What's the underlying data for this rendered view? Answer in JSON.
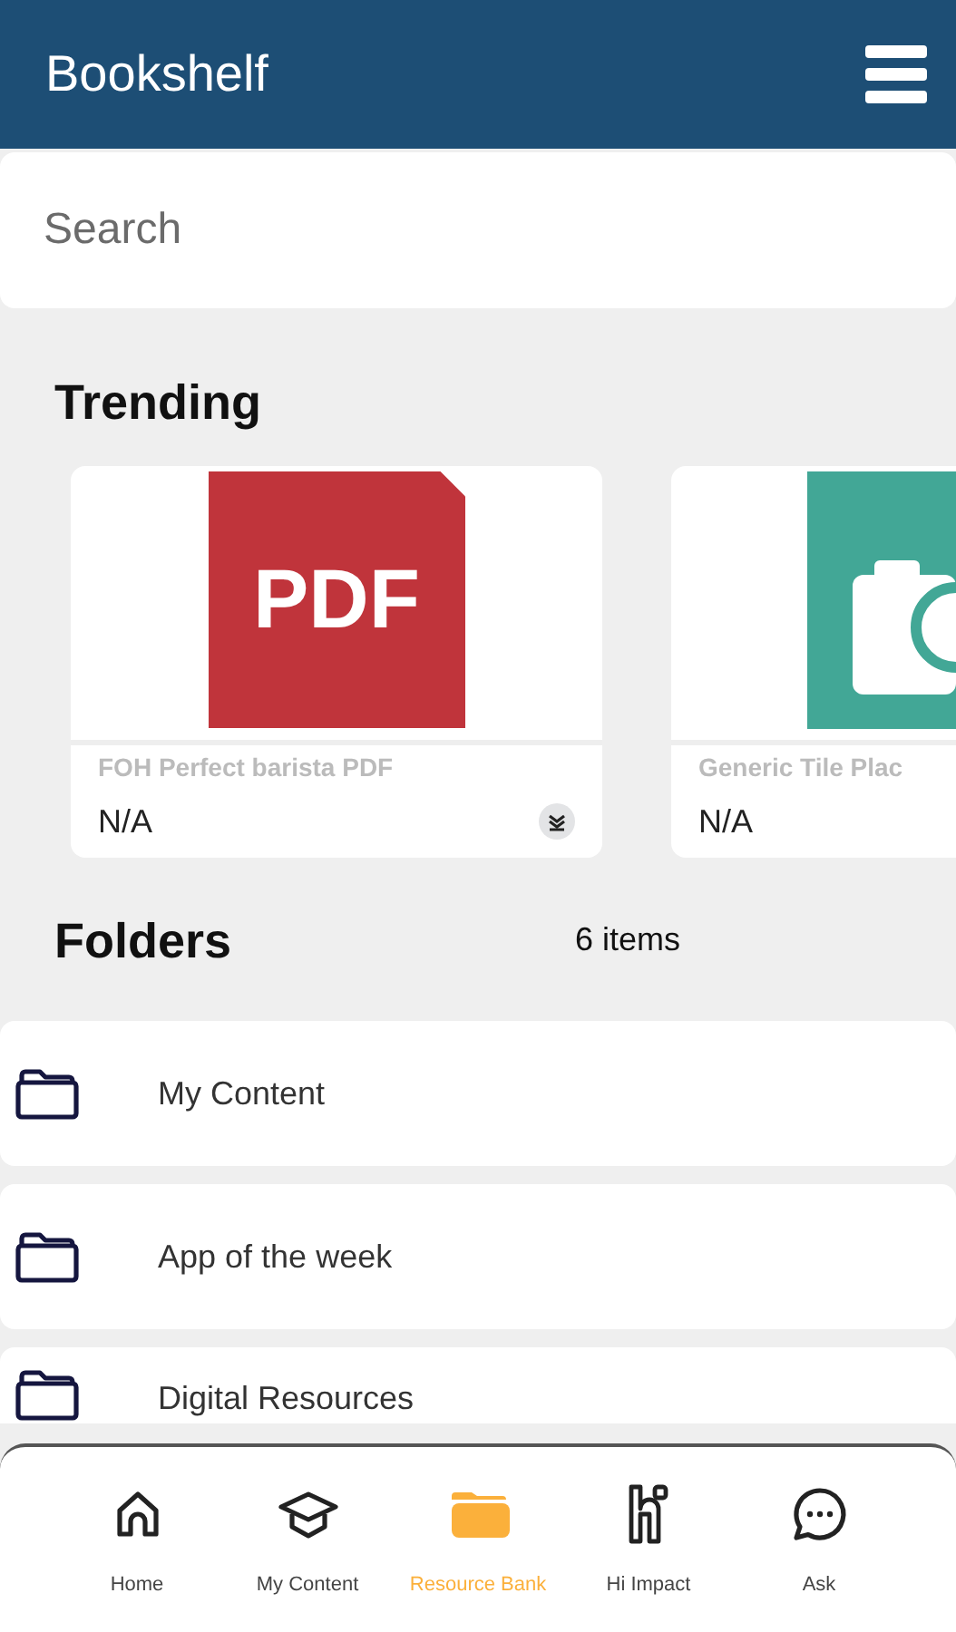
{
  "header": {
    "title": "Bookshelf"
  },
  "search": {
    "placeholder": "Search"
  },
  "trending": {
    "title": "Trending",
    "items": [
      {
        "kind": "pdf",
        "badge": "PDF",
        "name": "FOH Perfect barista PDF",
        "meta": "N/A",
        "download": true
      },
      {
        "kind": "image",
        "name": "Generic Tile Plac",
        "meta": "N/A"
      }
    ]
  },
  "folders": {
    "title": "Folders",
    "count": "6 items",
    "items": [
      {
        "name": "My Content"
      },
      {
        "name": "App of the week"
      },
      {
        "name": "Digital Resources"
      }
    ]
  },
  "bottom_nav": [
    {
      "kind": "home",
      "label": "Home",
      "selected": false
    },
    {
      "kind": "cap",
      "label": "My Content",
      "selected": false
    },
    {
      "kind": "folder",
      "label": "Resource Bank",
      "selected": true
    },
    {
      "kind": "hi",
      "label": "Hi Impact",
      "selected": false
    },
    {
      "kind": "chat",
      "label": "Ask",
      "selected": false
    }
  ]
}
